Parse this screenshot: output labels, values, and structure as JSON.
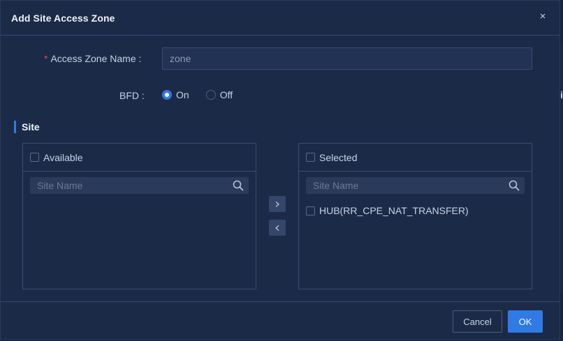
{
  "dialog": {
    "title": "Add Site Access Zone",
    "close_label": "×"
  },
  "form": {
    "zone_name": {
      "required_mark": "*",
      "label": "Access Zone Name :",
      "value": "zone"
    },
    "bfd": {
      "label": "BFD :",
      "options": [
        {
          "label": "On",
          "checked": true
        },
        {
          "label": "Off",
          "checked": false
        }
      ]
    }
  },
  "site_section": {
    "title": "Site",
    "available": {
      "header": "Available",
      "search_placeholder": "Site Name",
      "items": []
    },
    "selected": {
      "header": "Selected",
      "search_placeholder": "Site Name",
      "items": [
        "HUB(RR_CPE_NAT_TRANSFER)"
      ]
    },
    "move_right_icon": "chevron-right-icon",
    "move_left_icon": "chevron-left-icon"
  },
  "background": {
    "peek_text": "i"
  },
  "footer": {
    "cancel_label": "Cancel",
    "ok_label": "OK"
  },
  "colors": {
    "accent": "#2f7ae5",
    "required": "#e5484d",
    "dialog_bg": "#1b2a47"
  }
}
